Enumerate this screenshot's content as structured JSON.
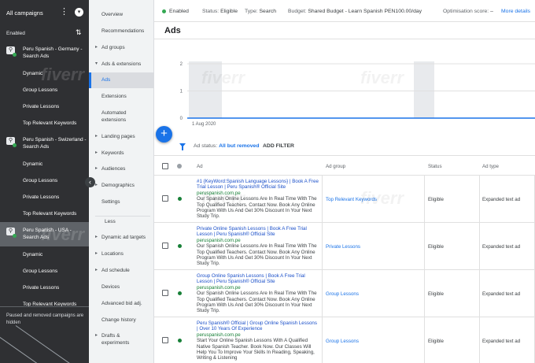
{
  "campaign_panel": {
    "title": "All campaigns",
    "filter_label": "Enabled",
    "campaigns": [
      {
        "name": "Peru Spanish - Germany - Search Ads",
        "ad_groups": [
          "Dynamic",
          "Group Lessons",
          "Private Lessons",
          "Top Relevant Keywords"
        ]
      },
      {
        "name": "Peru Spanish - Swizerland - Search Ads",
        "ad_groups": [
          "Dynamic",
          "Group Lessons",
          "Private Lessons",
          "Top Relevant Keywords"
        ]
      },
      {
        "name": "Peru Spanish - USA - Search Ads",
        "ad_groups": [
          "Dynamic",
          "Group Lessons",
          "Private Lessons",
          "Top Relevant Keywords"
        ]
      }
    ],
    "footer_note": "Paused and removed campaigns are hidden"
  },
  "page_nav": {
    "items": [
      "Overview",
      "Recommendations",
      "Ad groups",
      "Ads & extensions",
      "Ads",
      "Extensions",
      "Automated extensions",
      "Landing pages",
      "Keywords",
      "Audiences",
      "Demographics",
      "Settings",
      "Less",
      "Dynamic ad targets",
      "Locations",
      "Ad schedule",
      "Devices",
      "Advanced bid adj.",
      "Change history",
      "Drafts & experiments"
    ]
  },
  "topbar": {
    "status": "Enabled",
    "status_label": "Status:",
    "status_value": "Eligible",
    "type_label": "Type:",
    "type_value": "Search",
    "budget_label": "Budget:",
    "budget_value": "Shared Budget - Learn Spanish PEN100.00/day",
    "optimisation_label": "Optimisation score:",
    "optimisation_value": "–",
    "more_details": "More details"
  },
  "page_title": "Ads",
  "chart_data": {
    "type": "line",
    "y_ticks": [
      "2",
      "1",
      "0"
    ],
    "ylim": [
      0,
      2
    ],
    "x_start_label": "1 Aug 2020",
    "values": [
      0,
      0,
      0,
      0,
      0,
      0,
      0,
      0,
      0,
      0
    ],
    "grid": true
  },
  "filter": {
    "label": "Ad status:",
    "value": "All but removed",
    "add_filter": "ADD FILTER"
  },
  "table": {
    "columns": [
      "Ad",
      "Ad group",
      "Status",
      "Ad type"
    ],
    "rows": [
      {
        "headline": "#1 {KeyWord:Spanish Language Lessons} | Book A Free Trial Lesson | Peru Spanish® Official Site",
        "url": "peruspanish.com.pe",
        "description": "Our Spanish Online Lessons Are In Real Time With The Top Qualified Teachers. Contact Now. Book Any Online Program With Us And Get 30% Discount In Your Next Study Trip.",
        "ad_group": "Top Relevant Keywords",
        "status": "Eligible",
        "ad_type": "Expanded text ad"
      },
      {
        "headline": "Private Online Spanish Lessons | Book A Free Trial Lesson | Peru Spanish® Official Site",
        "url": "peruspanish.com.pe",
        "description": "Our Spanish Online Lessons Are In Real Time With The Top Qualified Teachers. Contact Now. Book Any Online Program With Us And Get 30% Discount In Your Next Study Trip.",
        "ad_group": "Private Lessons",
        "status": "Eligible",
        "ad_type": "Expanded text ad"
      },
      {
        "headline": "Group Online Spanish Lessons | Book A Free Trial Lesson | Peru Spanish® Official Site",
        "url": "peruspanish.com.pe",
        "description": "Our Spanish Online Lessons Are In Real Time With The Top Qualified Teachers. Contact Now. Book Any Online Program With Us And Get 30% Discount In Your Next Study Trip.",
        "ad_group": "Group Lessons",
        "status": "Eligible",
        "ad_type": "Expanded text ad"
      },
      {
        "headline": "Peru Spanish® Official | Group Online Spanish Lessons | Over 10 Years Of Experience",
        "url": "peruspanish.com.pe",
        "description": "Start Your Online Spanish Lessons With A Qualified Native Spanish Teacher. Book Now. Our Classes Will Help You To Improve Your Skills In Reading, Speaking, Writing & Listening",
        "ad_group": "Group Lessons",
        "status": "Eligible",
        "ad_type": "Expanded text ad"
      }
    ]
  },
  "watermark": "fiverr",
  "colors": {
    "accent": "#1a73e8",
    "enabled_green": "#34a853",
    "panel_dark": "#2f3033"
  }
}
